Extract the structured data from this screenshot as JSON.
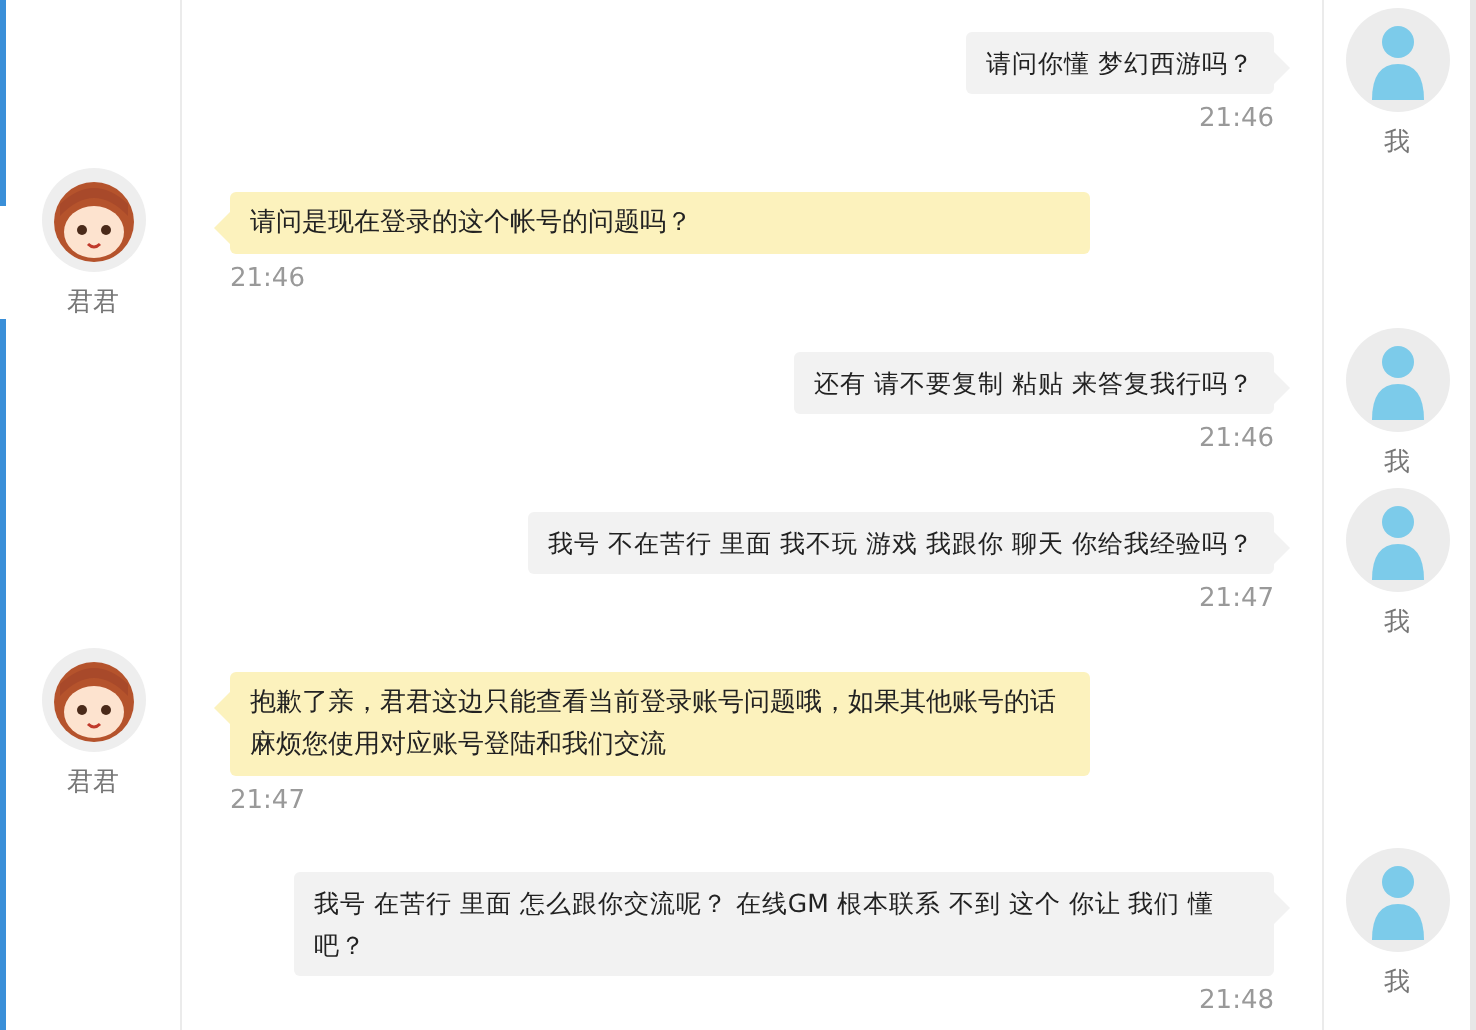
{
  "messages": [
    {
      "kind": "user",
      "name": "我",
      "text": "请问你懂 梦幻西游吗？",
      "time": "21:46"
    },
    {
      "kind": "agent",
      "name": "君君",
      "text": "请问是现在登录的这个帐号的问题吗？",
      "time": "21:46"
    },
    {
      "kind": "user",
      "name": "我",
      "text": "还有 请不要复制 粘贴 来答复我行吗？",
      "time": "21:46"
    },
    {
      "kind": "user",
      "name": "我",
      "text": "我号 不在苦行 里面 我不玩 游戏 我跟你 聊天 你给我经验吗？",
      "time": "21:47"
    },
    {
      "kind": "agent",
      "name": "君君",
      "text": "抱歉了亲，君君这边只能查看当前登录账号问题哦，如果其他账号的话麻烦您使用对应账号登陆和我们交流",
      "time": "21:47"
    },
    {
      "kind": "user",
      "name": "我",
      "text": "我号 在苦行 里面 怎么跟你交流呢？  在线GM 根本联系 不到 这个 你让 我们 懂吧？",
      "time": "21:48"
    }
  ]
}
